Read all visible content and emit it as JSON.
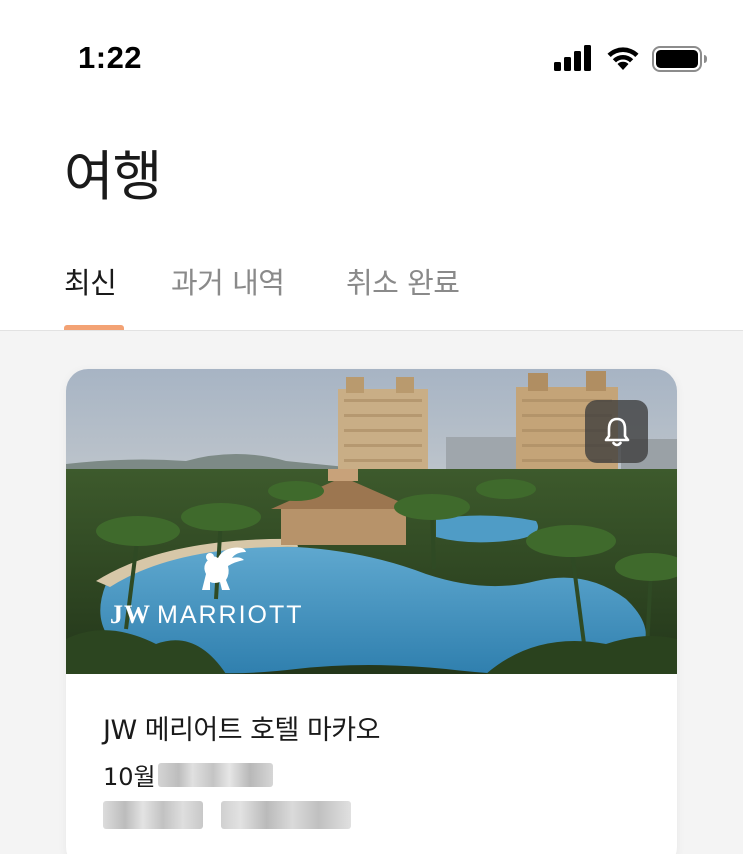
{
  "status_bar": {
    "time": "1:22",
    "icons": [
      "cellular-signal-icon",
      "wifi-icon",
      "battery-icon"
    ]
  },
  "page": {
    "title": "여행"
  },
  "tabs": [
    {
      "label": "최신",
      "active": true
    },
    {
      "label": "과거 내역",
      "active": false
    },
    {
      "label": "취소 완료",
      "active": false
    }
  ],
  "colors": {
    "accent": "#f3a274",
    "content_background": "#f4f4f4",
    "inactive_tab": "#8a8a8a"
  },
  "trips": [
    {
      "hotel_name": "JW 메리어트 호텔 마카오",
      "date_prefix": "10월",
      "brand_logo": {
        "jw": "JW",
        "brand": "MARRIOTT"
      },
      "action_icon": "bell-icon"
    }
  ]
}
